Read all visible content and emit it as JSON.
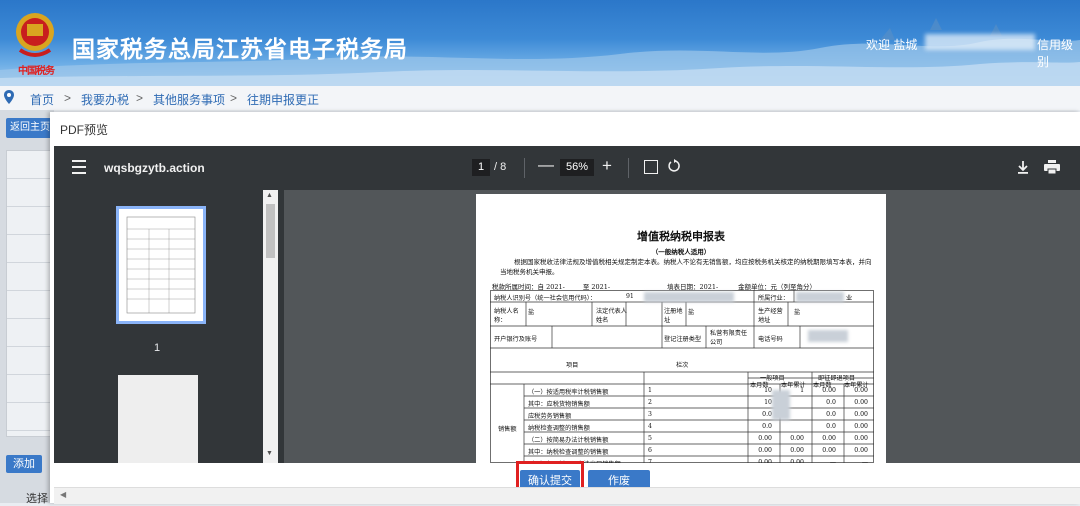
{
  "header": {
    "logo_text": "中国税务",
    "site_title": "国家税务总局江苏省电子税务局",
    "welcome": "欢迎 盐城",
    "user_level": "信用级别",
    "colors": {
      "bg": "#3d8ad6",
      "text": "#ffffff"
    }
  },
  "breadcrumb": {
    "icon": "location-pin-icon",
    "items": [
      "首页",
      "我要办税",
      "其他服务事项",
      "往期申报更正"
    ],
    "separator": ">"
  },
  "under": {
    "back_label": "返回主页",
    "add_label": "添加",
    "select_label": "选择"
  },
  "modal": {
    "title": "PDF预览"
  },
  "viewer": {
    "file_name": "wqsbgzytb.action",
    "page_current": "1",
    "page_total": "/ 8",
    "zoom": "56%",
    "minus": "—",
    "plus": "+",
    "thumb_label": "1",
    "icons": [
      "menu-icon",
      "fit-page-icon",
      "rotate-icon",
      "download-icon",
      "print-icon"
    ]
  },
  "doc": {
    "title": "增值税纳税申报表",
    "subtitle": "（一般纳税人适用）",
    "intro": "根据国家税收法律法规及增值税相关规定制定本表。纳税人不论有无销售额，均应按税务机关核定的纳税期限填写本表，并向当地税务机关申报。",
    "period": "税款所属时间：自 2021-",
    "period_to": "至 2021-",
    "fill_date": "填表日期：2021-",
    "unit": "金额单位：元（列至角分）",
    "tax_id_label": "纳税人识别号（统一社会信用代码）：",
    "tax_id_val": "91",
    "industry_label": "所属行业：",
    "industry_val": "业",
    "name_label": "纳税人名称：",
    "name_val": "盐",
    "legal_label": "法定代表人姓名",
    "reg_addr_label": "注册地址",
    "reg_addr_val": "盐",
    "biz_addr_label": "生产经营地址",
    "biz_addr_val": "盐",
    "bank_label": "开户银行及账号",
    "reg_type_label": "登记注册类型",
    "reg_type_val": "私营有限责任公司",
    "phone_label": "电话号码",
    "col_item": "项目",
    "col_line": "栏次",
    "col_general": "一般项目",
    "col_refund": "即征即退项目",
    "col_month": "本月数",
    "col_year": "本年累计",
    "group_label": "销售额",
    "rows": [
      {
        "item": "（一）按适用税率计税销售额",
        "no": "1",
        "m": "10",
        "y": "1",
        "rm": "0.00",
        "ry": "0.00"
      },
      {
        "item": "其中：应税货物销售额",
        "no": "2",
        "m": "10",
        "y": "",
        "rm": "0.0",
        "ry": "0.00"
      },
      {
        "item": "应税劳务销售额",
        "no": "3",
        "m": "0.0",
        "y": "",
        "rm": "0.0",
        "ry": "0.00"
      },
      {
        "item": "纳税检查调整的销售额",
        "no": "4",
        "m": "0.0",
        "y": "",
        "rm": "0.0",
        "ry": "0.00"
      },
      {
        "item": "（二）按简易办法计税销售额",
        "no": "5",
        "m": "0.00",
        "y": "0.00",
        "rm": "0.00",
        "ry": "0.00"
      },
      {
        "item": "其中：纳税检查调整的销售额",
        "no": "6",
        "m": "0.00",
        "y": "0.00",
        "rm": "0.00",
        "ry": "0.00"
      },
      {
        "item": "（三）免、抵、退办法出口销售额",
        "no": "7",
        "m": "0.00",
        "y": "0.00",
        "rm": "—",
        "ry": "—"
      }
    ]
  },
  "footer": {
    "confirm_label": "确认提交",
    "void_label": "作废"
  }
}
